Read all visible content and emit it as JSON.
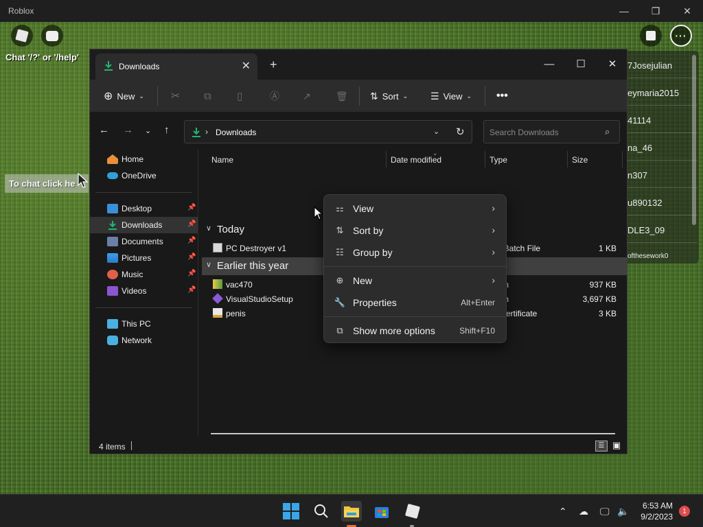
{
  "roblox": {
    "window_title": "Roblox",
    "chat_hint": "Chat '/?' or '/help'",
    "to_chat": "To chat click he",
    "leaderboard": [
      "7Josejulian",
      "eymaria2015",
      "41114",
      "na_46",
      "n307",
      "u890132",
      "DLE3_09",
      "ofthesework0"
    ]
  },
  "explorer": {
    "tab_title": "Downloads",
    "toolbar": {
      "new_label": "New",
      "sort_label": "Sort",
      "view_label": "View"
    },
    "address": "Downloads",
    "search_placeholder": "Search Downloads",
    "sidebar": {
      "top": [
        {
          "label": "Home"
        },
        {
          "label": "OneDrive"
        }
      ],
      "pinned": [
        {
          "label": "Desktop"
        },
        {
          "label": "Downloads"
        },
        {
          "label": "Documents"
        },
        {
          "label": "Pictures"
        },
        {
          "label": "Music"
        },
        {
          "label": "Videos"
        }
      ],
      "bottom": [
        {
          "label": "This PC"
        },
        {
          "label": "Network"
        }
      ]
    },
    "columns": {
      "name": "Name",
      "date": "Date modified",
      "type": "Type",
      "size": "Size"
    },
    "groups": [
      {
        "label": "Today",
        "files": [
          {
            "name": "PC Destroyer v1",
            "type": "ows Batch File",
            "size": "1 KB"
          }
        ]
      },
      {
        "label": "Earlier this year",
        "files": [
          {
            "name": "vac470",
            "type": "cation",
            "size": "937 KB"
          },
          {
            "name": "VisualStudioSetup",
            "type": "cation",
            "size": "3,697 KB"
          },
          {
            "name": "penis",
            "type": "rity Certificate",
            "size": "3 KB"
          }
        ]
      }
    ],
    "status": "4 items"
  },
  "context_menu": {
    "items": [
      {
        "label": "View",
        "icon": "grid-icon",
        "shortcut": ""
      },
      {
        "label": "Sort by",
        "icon": "sort-icon",
        "shortcut": ""
      },
      {
        "label": "Group by",
        "icon": "list-icon",
        "shortcut": ""
      },
      {
        "label": "New",
        "icon": "plus-circle-icon",
        "shortcut": ""
      },
      {
        "label": "Properties",
        "icon": "wrench-icon",
        "shortcut": "Alt+Enter"
      },
      {
        "label": "Show more options",
        "icon": "share-icon",
        "shortcut": "Shift+F10"
      }
    ]
  },
  "taskbar": {
    "time": "6:53 AM",
    "date": "9/2/2023",
    "notifications": "1"
  },
  "colors": {
    "accent": "#2fa0d8",
    "folder_green": "#22b573",
    "menu_bg": "#2c2c2c",
    "window_bg": "#191919"
  }
}
